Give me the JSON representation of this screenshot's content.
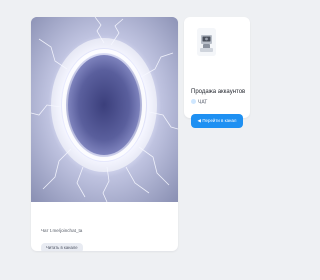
{
  "post": {
    "caption": "Чат t.me/joinchat_ta",
    "tag": "Читать в канале"
  },
  "channel": {
    "title": "Продажа аккаунтов",
    "subtitle": "ЧАТ",
    "button_icon": "arrow-left-icon",
    "button_label": "Перейти в канал"
  },
  "colors": {
    "page_background": "#eef0f3",
    "card_background": "#ffffff",
    "accent": "#1e90f2",
    "tag_background": "#e8ebf2",
    "image_glow": "#a9aec9"
  }
}
